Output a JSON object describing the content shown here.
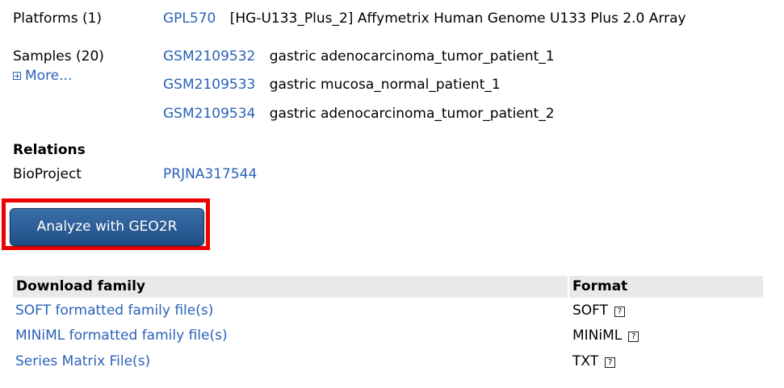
{
  "platforms": {
    "label": "Platforms (1)",
    "id": "GPL570",
    "description": "[HG-U133_Plus_2] Affymetrix Human Genome U133 Plus 2.0 Array"
  },
  "samples": {
    "label": "Samples (20)",
    "more": "More...",
    "items": [
      {
        "id": "GSM2109532",
        "desc": "gastric adenocarcinoma_tumor_patient_1"
      },
      {
        "id": "GSM2109533",
        "desc": "gastric mucosa_normal_patient_1"
      },
      {
        "id": "GSM2109534",
        "desc": "gastric adenocarcinoma_tumor_patient_2"
      }
    ]
  },
  "relations": {
    "heading": "Relations",
    "bioproject_label": "BioProject",
    "bioproject_id": "PRJNA317544"
  },
  "geo2r_button": "Analyze with GEO2R",
  "download": {
    "header_family": "Download family",
    "header_format": "Format",
    "rows": [
      {
        "name": "SOFT formatted family file(s)",
        "format": "SOFT",
        "help": "?"
      },
      {
        "name": "MINiML formatted family file(s)",
        "format": "MINiML",
        "help": "?"
      },
      {
        "name": "Series Matrix File(s)",
        "format": "TXT",
        "help": "?"
      }
    ]
  },
  "colors": {
    "link": "#2a62b8",
    "highlight": "#ee0000",
    "button": "#2b5f99",
    "table_header": "#e9e9e9"
  },
  "icons": {
    "more": "plus-box-icon",
    "help": "help-box-icon"
  }
}
